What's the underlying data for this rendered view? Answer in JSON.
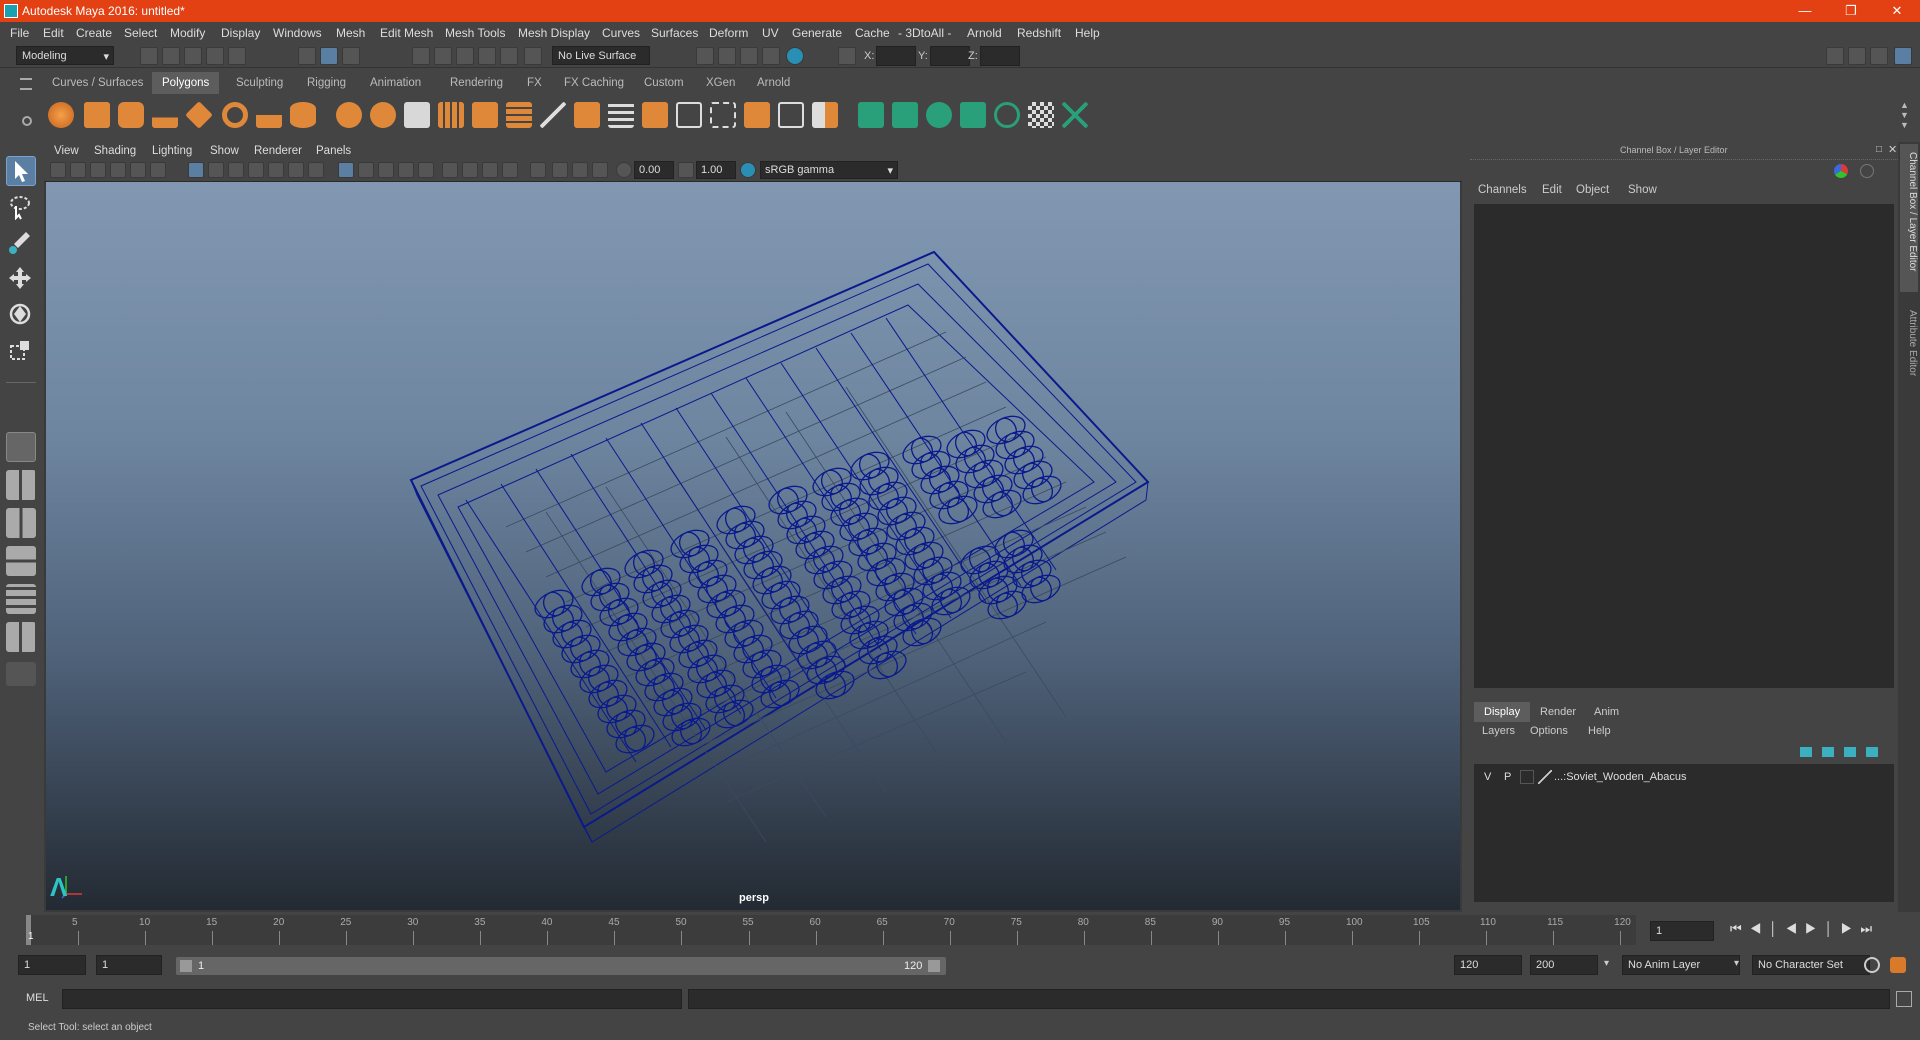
{
  "window": {
    "title": "Autodesk Maya 2016: untitled*"
  },
  "menubar": [
    "File",
    "Edit",
    "Create",
    "Select",
    "Modify",
    "Display",
    "Windows",
    "Mesh",
    "Edit Mesh",
    "Mesh Tools",
    "Mesh Display",
    "Curves",
    "Surfaces",
    "Deform",
    "UV",
    "Generate",
    "Cache",
    "- 3DtoAll -",
    "Arnold",
    "Redshift",
    "Help"
  ],
  "statusline": {
    "mode": "Modeling",
    "live_surface": "No Live Surface",
    "x_label": "X:",
    "y_label": "Y:",
    "z_label": "Z:"
  },
  "shelf_tabs": [
    "Curves / Surfaces",
    "Polygons",
    "Sculpting",
    "Rigging",
    "Animation",
    "Rendering",
    "FX",
    "FX Caching",
    "Custom",
    "XGen",
    "Arnold"
  ],
  "shelf_active": "Polygons",
  "viewport": {
    "menus": [
      "View",
      "Shading",
      "Lighting",
      "Show",
      "Renderer",
      "Panels"
    ],
    "exposure": "0.00",
    "gamma": "1.00",
    "color_space": "sRGB gamma",
    "camera_label": "persp"
  },
  "channelbox": {
    "header": "Channel Box / Layer Editor",
    "menus": [
      "Channels",
      "Edit",
      "Object",
      "Show"
    ]
  },
  "layer_editor": {
    "tabs": [
      "Display",
      "Render",
      "Anim"
    ],
    "active_tab": "Display",
    "menus": [
      "Layers",
      "Options",
      "Help"
    ],
    "layers": [
      {
        "v": "V",
        "p": "P",
        "name": "...:Soviet_Wooden_Abacus"
      }
    ]
  },
  "side_tabs": [
    "Channel Box / Layer Editor",
    "Attribute Editor"
  ],
  "timeline": {
    "ticks": [
      "5",
      "10",
      "15",
      "20",
      "25",
      "30",
      "35",
      "40",
      "45",
      "50",
      "55",
      "60",
      "65",
      "70",
      "75",
      "80",
      "85",
      "90",
      "95",
      "100",
      "105",
      "110",
      "115",
      "120"
    ],
    "current_frame_marker": "1",
    "current_frame_field": "1"
  },
  "range": {
    "start": "1",
    "anim_start": "1",
    "slider_start": "1",
    "slider_end": "120",
    "end": "120",
    "anim_end": "200",
    "anim_layer": "No Anim Layer",
    "character_set": "No Character Set"
  },
  "mel": {
    "label": "MEL"
  },
  "help_line": "Select Tool: select an object",
  "colors": {
    "title_bar": "#e34113",
    "wireframe": "#0a1a8c",
    "accent": "#5d5d5d"
  }
}
